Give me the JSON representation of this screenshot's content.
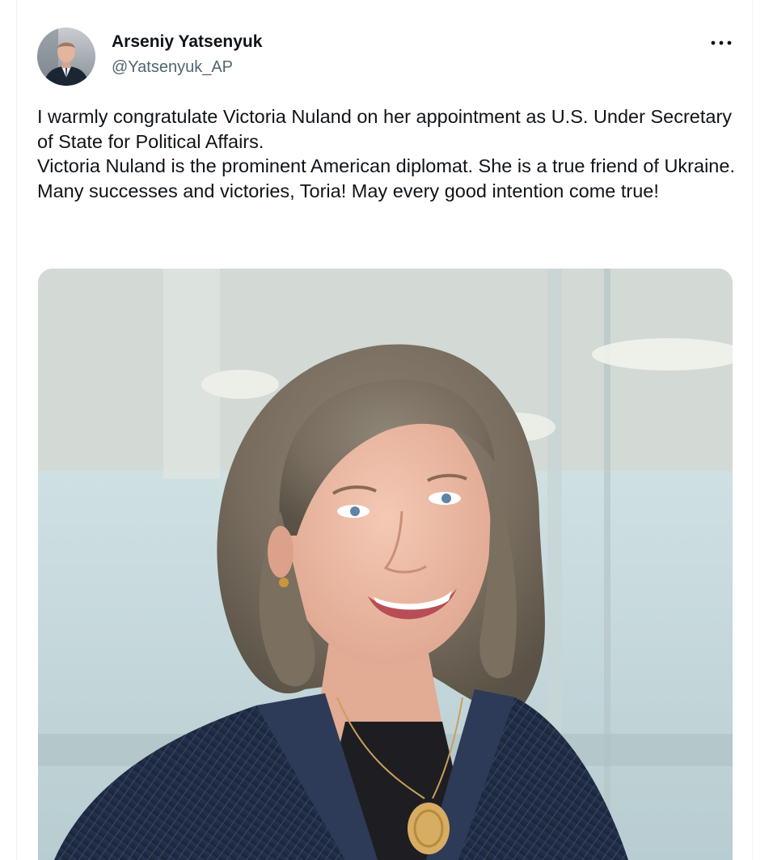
{
  "author": {
    "name": "Arseniy Yatsenyuk",
    "handle": "@Yatsenyuk_AP"
  },
  "tweet": {
    "lines": [
      "I warmly congratulate Victoria Nuland on her appointment as U.S. Under Secretary of State for Political Affairs.",
      "Victoria Nuland is the prominent American diplomat. She is a true friend of Ukraine.",
      "Many successes and victories, Toria! May every good intention come true!"
    ]
  },
  "icons": {
    "more": "more-horizontal-icon"
  },
  "colors": {
    "text_primary": "#0f1419",
    "text_secondary": "#536471",
    "divider": "#eff3f4"
  }
}
